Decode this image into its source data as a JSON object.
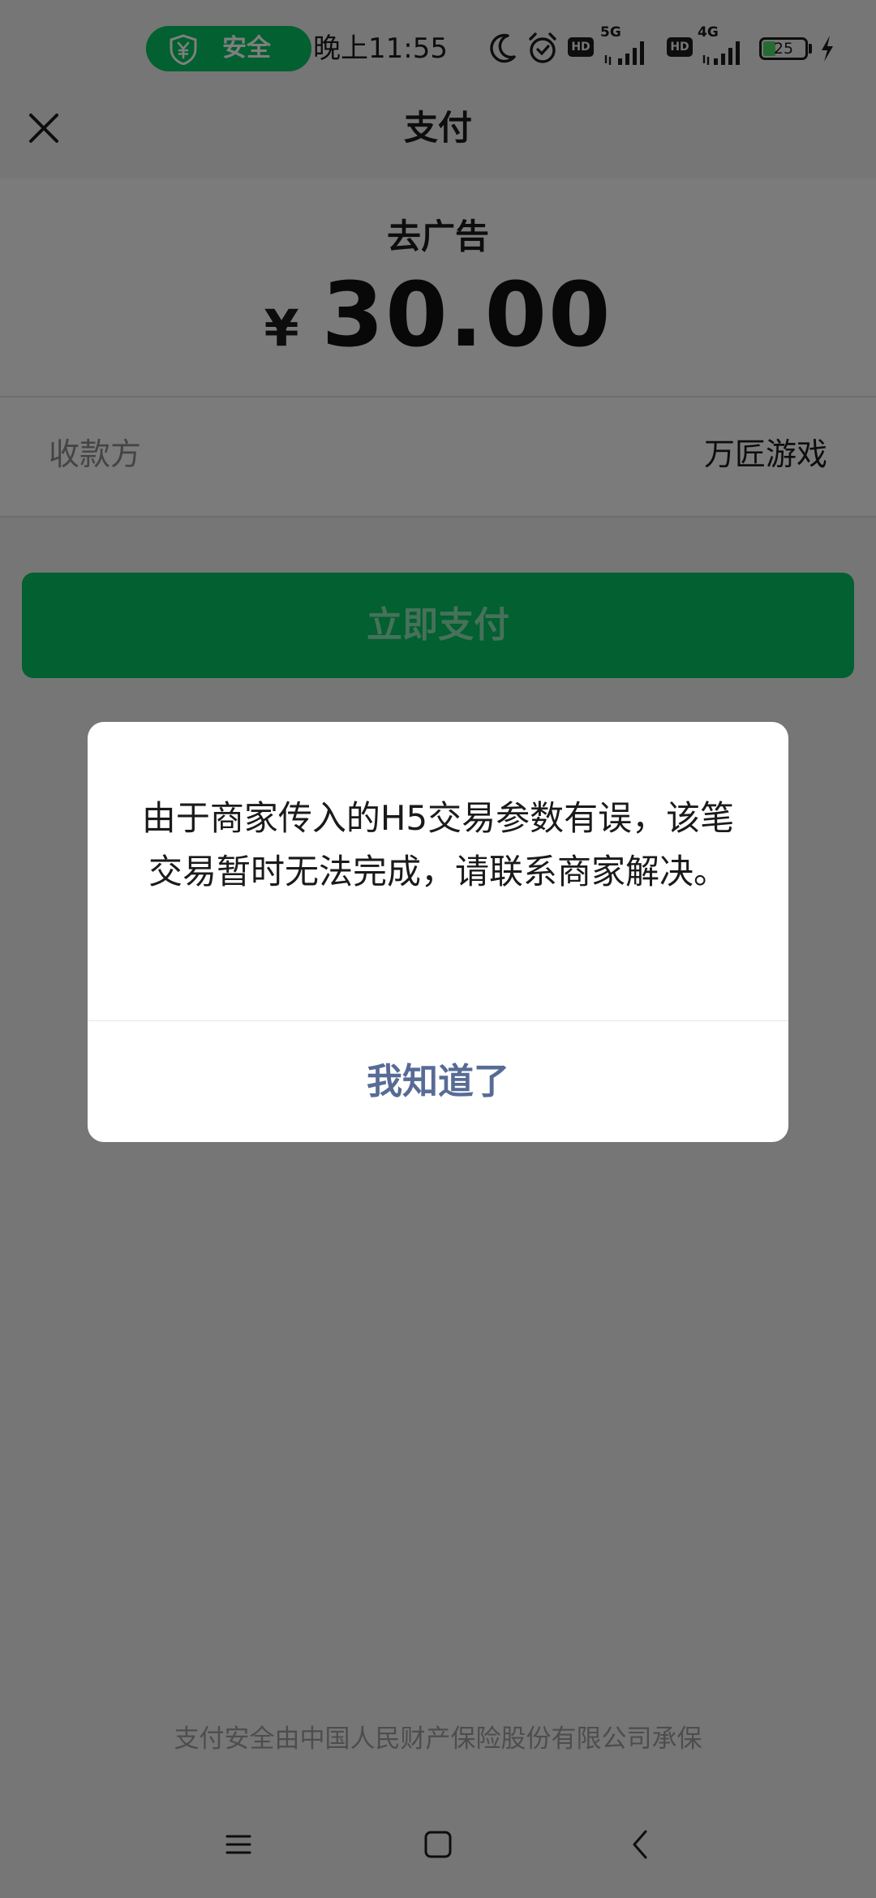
{
  "status_bar": {
    "security_label": "安全",
    "time": "晚上11:55",
    "hd_tag": "HD",
    "network_1": "5G",
    "network_2": "4G",
    "battery_level": "25",
    "icons": [
      "moon-icon",
      "alarm-icon",
      "signal-icon",
      "battery-icon",
      "charging-icon"
    ]
  },
  "header": {
    "title": "支付"
  },
  "payment": {
    "product_name": "去广告",
    "currency_symbol": "¥",
    "amount": "30.00",
    "payee_label": "收款方",
    "payee_name": "万匠游戏",
    "pay_button_label": "立即支付"
  },
  "dialog": {
    "message": "由于商家传入的H5交易参数有误，该笔交易暂时无法完成，请联系商家解决。",
    "confirm_label": "我知道了"
  },
  "footer": {
    "note": "支付安全由中国人民财产保险股份有限公司承保"
  },
  "colors": {
    "brand_green": "#07c160",
    "link_blue": "#576b95",
    "background": "#ededed"
  }
}
